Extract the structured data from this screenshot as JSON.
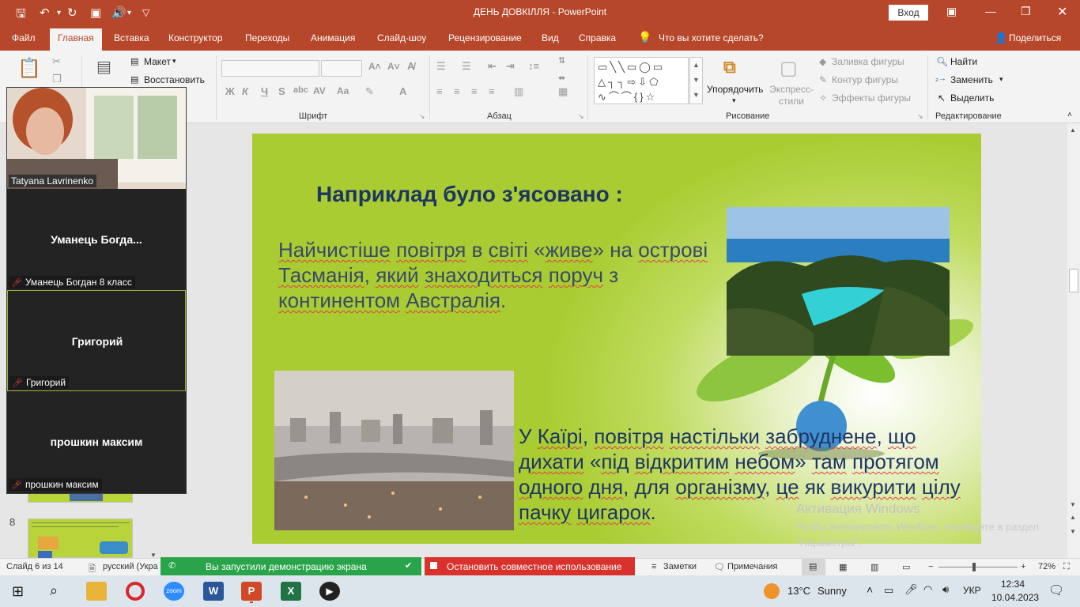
{
  "window": {
    "title": "ДЕНЬ ДОВКІЛЛЯ  -  PowerPoint",
    "login_label": "Вход",
    "title_bg": "#b7472a"
  },
  "tabs": [
    {
      "label": "Файл"
    },
    {
      "label": "Главная",
      "active": true
    },
    {
      "label": "Вставка"
    },
    {
      "label": "Конструктор"
    },
    {
      "label": "Переходы"
    },
    {
      "label": "Анимация"
    },
    {
      "label": "Слайд-шоу"
    },
    {
      "label": "Рецензирование"
    },
    {
      "label": "Вид"
    },
    {
      "label": "Справка"
    },
    {
      "label": "Что вы хотите сделать?"
    }
  ],
  "share_label": "Поделиться",
  "ribbon": {
    "slides": {
      "layout": "Макет",
      "reset": "Восстановить"
    },
    "font_group": "Шрифт",
    "paragraph_group": "Абзац",
    "drawing_group": "Рисование",
    "arrange": "Упорядочить",
    "quick_styles": "Экспресс-стили",
    "shape_fill": "Заливка фигуры",
    "shape_outline": "Контур фигуры",
    "shape_effects": "Эффекты фигуры",
    "find": "Найти",
    "replace": "Заменить",
    "select": "Выделить",
    "editing_group": "Редактирование"
  },
  "video": {
    "tiles": [
      {
        "name": "Tatyana Lavrinenko",
        "type": "camera"
      },
      {
        "display": "Уманець  Богда...",
        "label": "Уманець Богдан 8 класс"
      },
      {
        "display": "Григорий",
        "label": "Григорий",
        "active": true
      },
      {
        "display": "прошкин максим",
        "label": "прошкин максим"
      }
    ]
  },
  "thumbnails": [
    {
      "number": "8"
    }
  ],
  "slide": {
    "title": "Наприклад було з'ясовано :",
    "para1": [
      "Найчистіше",
      " ",
      "повітря",
      " в ",
      "світі",
      " «",
      "живе",
      "» на ",
      "острові",
      " ",
      "Тасманія",
      ", ",
      "який",
      " ",
      "знаходиться",
      " ",
      "поруч",
      " з ",
      "континентом",
      " ",
      "Австралія",
      "."
    ],
    "para2": [
      " У ",
      "Каїрі",
      ", ",
      "повітря",
      " ",
      "настільки",
      " ",
      "забруднене",
      ", ",
      "що",
      " ",
      "дихати",
      " «",
      "під",
      " ",
      "відкритим",
      " ",
      "небом",
      "» ",
      "там",
      " ",
      "протягом",
      " ",
      "одного",
      " ",
      "дня",
      ", для ",
      "організму",
      ", ",
      "це",
      " як ",
      "викурити",
      " ",
      "цілу",
      " ",
      "пачку",
      " ",
      "цигарок",
      "."
    ]
  },
  "watermark": {
    "line1": "Активация Windows",
    "line2": "Чтобы активировать Windows, перейдите в раздел \"Параметры\"."
  },
  "status": {
    "slide_counter": "Слайд 6 из 14",
    "language": "русский (Укра",
    "share_notice": "Вы запустили демонстрацию экрана",
    "stop_share": "Остановить совместное использование",
    "notes": "Заметки",
    "comments": "Примечания",
    "zoom": "72%",
    "zoom_value": 0.72
  },
  "taskbar": {
    "weather_temp": "13°C",
    "weather_text": "Sunny",
    "language": "УКР",
    "time": "12:34",
    "date": "10.04.2023"
  }
}
